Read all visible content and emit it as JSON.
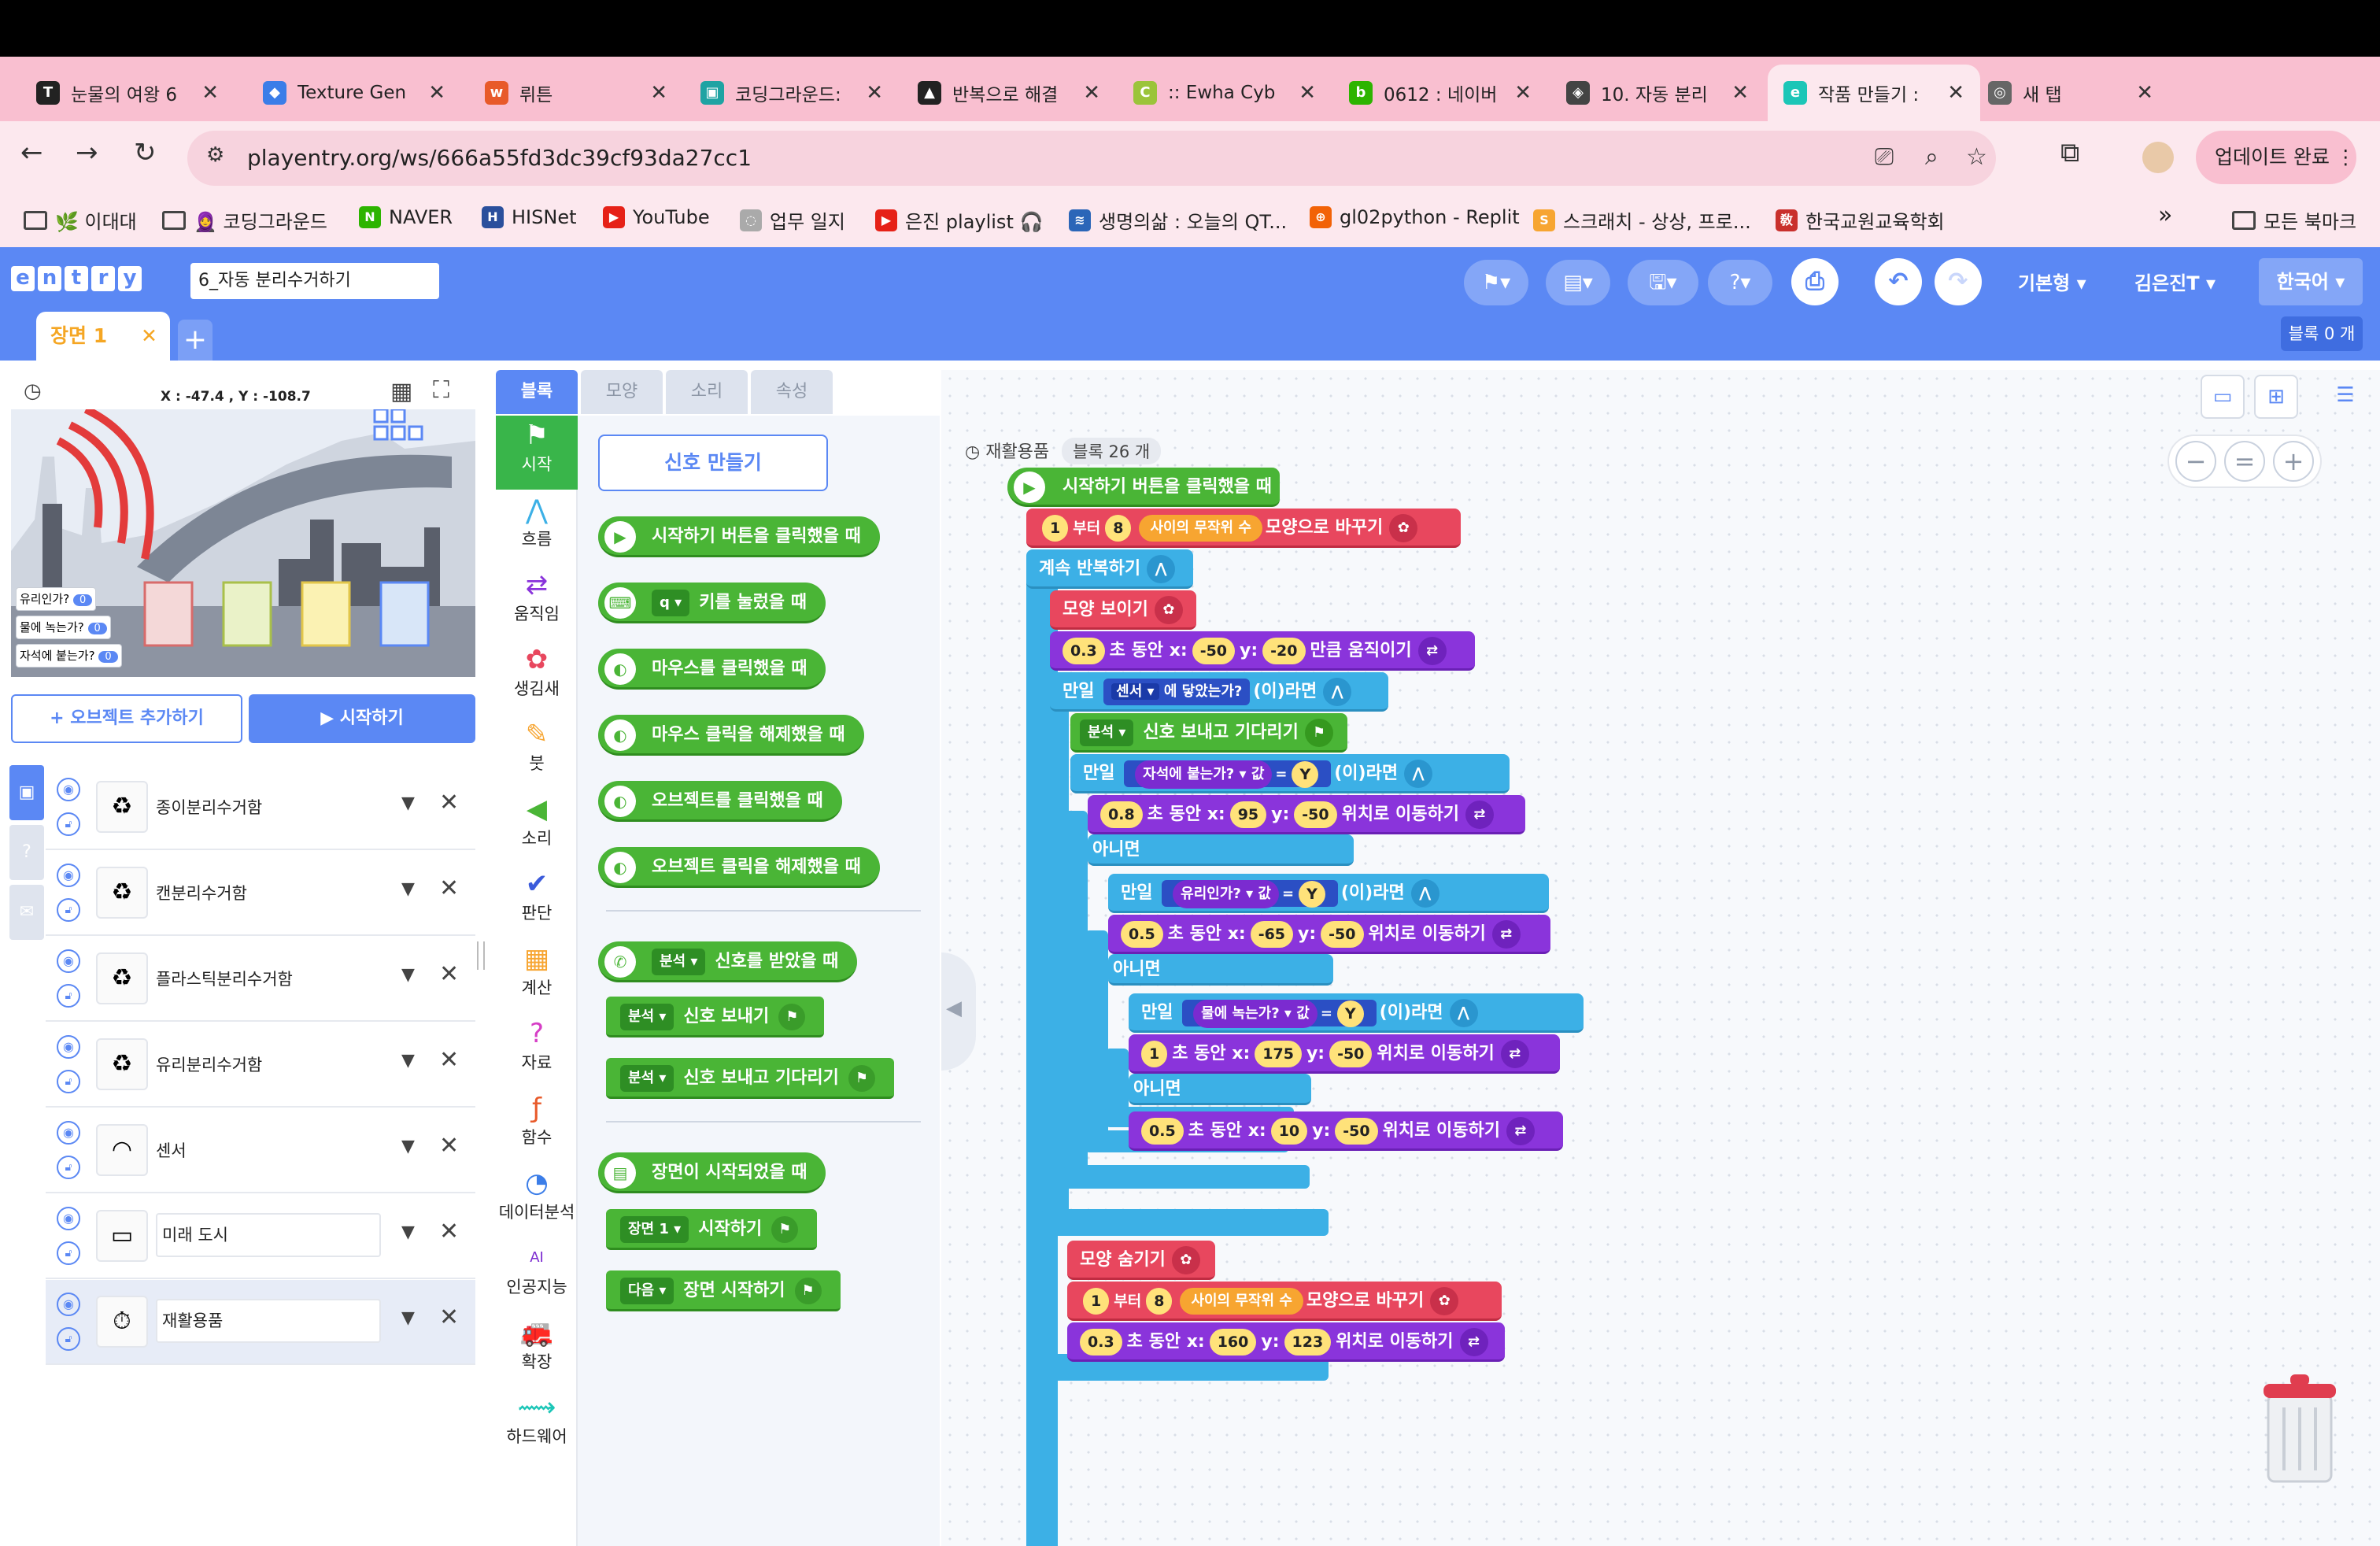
{
  "browser": {
    "tabs": [
      {
        "title": "눈물의 여왕 6",
        "fav": "T",
        "color": "#222"
      },
      {
        "title": "Texture Gen",
        "fav": "◆",
        "color": "#3b7de8"
      },
      {
        "title": "뤼튼",
        "fav": "w",
        "color": "#e85a2a"
      },
      {
        "title": "코딩그라운드:",
        "fav": "▣",
        "color": "#1fa3a3"
      },
      {
        "title": "반복으로 해결",
        "fav": "▲",
        "color": "#222"
      },
      {
        "title": ":: Ewha Cyb",
        "fav": "C",
        "color": "#9bc43a"
      },
      {
        "title": "0612 : 네이버",
        "fav": "b",
        "color": "#2db400"
      },
      {
        "title": "10. 자동 분리",
        "fav": "◈",
        "color": "#444"
      },
      {
        "title": "작품 만들기 :",
        "fav": "e",
        "color": "#1cc6b7"
      },
      {
        "title": "새 탭",
        "fav": "◎",
        "color": "#666"
      }
    ],
    "new_tab": "+",
    "url": "playentry.org/ws/666a55fd3dc39cf93da27cc1",
    "update_label": "업데이트 완료",
    "bookmarks": [
      {
        "label": "🌿 이대대",
        "icon": "folder"
      },
      {
        "label": "🧕 코딩그라운드",
        "icon": "folder"
      },
      {
        "label": "NAVER",
        "icon": "N",
        "color": "#2db400"
      },
      {
        "label": "HISNet",
        "icon": "H",
        "color": "#2a4f9c"
      },
      {
        "label": "YouTube",
        "icon": "▶",
        "color": "#e62117"
      },
      {
        "label": "업무 일지",
        "icon": "◌",
        "color": "#aaa"
      },
      {
        "label": "은진 playlist 🎧",
        "icon": "▶",
        "color": "#e62117"
      },
      {
        "label": "생명의삶 : 오늘의 QT...",
        "icon": "≋",
        "color": "#2b66b8"
      },
      {
        "label": "gl02python - Replit",
        "icon": "⊕",
        "color": "#f26207"
      },
      {
        "label": "스크래치 - 상상, 프로...",
        "icon": "S",
        "color": "#f7a531"
      },
      {
        "label": "한국교원교육학회",
        "icon": "敎",
        "color": "#c9302c"
      }
    ],
    "more": "»",
    "all_bookmarks": "모든 북마크"
  },
  "entry": {
    "logo": [
      "e",
      "n",
      "t",
      "r",
      "y"
    ],
    "project_name": "6_자동 분리수거하기",
    "mode": "기본형",
    "user": "김은진T",
    "language": "한국어",
    "scene_tab": "장면 1",
    "block_count": "블록 0 개",
    "coords": "X : -47.4 , Y : -108.7",
    "stage_vars": [
      {
        "label": "유리인가?",
        "value": "0"
      },
      {
        "label": "물에 녹는가?",
        "value": "0"
      },
      {
        "label": "자석에 붙는가?",
        "value": "0"
      }
    ],
    "add_object": "+ 오브젝트 추가하기",
    "start": "▶ 시작하기",
    "objects": [
      {
        "name": "종이분리수거함",
        "icon": "♻"
      },
      {
        "name": "캔분리수거함",
        "icon": "♻"
      },
      {
        "name": "플라스틱분리수거함",
        "icon": "♻"
      },
      {
        "name": "유리분리수거함",
        "icon": "♻"
      },
      {
        "name": "센서",
        "icon": "◠"
      },
      {
        "name": "미래 도시",
        "icon": "▭"
      },
      {
        "name": "재활용품",
        "icon": "⏱"
      }
    ],
    "palette_tabs": [
      "블록",
      "모양",
      "소리",
      "속성"
    ],
    "categories": [
      {
        "label": "시작",
        "icon": "⚑",
        "color": "#fff"
      },
      {
        "label": "흐름",
        "icon": "⋀",
        "color": "#3cb0e6"
      },
      {
        "label": "움직임",
        "icon": "⇄",
        "color": "#8a34db"
      },
      {
        "label": "생김새",
        "icon": "✿",
        "color": "#e8475e"
      },
      {
        "label": "붓",
        "icon": "✎",
        "color": "#f7a531"
      },
      {
        "label": "소리",
        "icon": "◀",
        "color": "#4ab536"
      },
      {
        "label": "판단",
        "icon": "✔",
        "color": "#3b5bdb"
      },
      {
        "label": "계산",
        "icon": "▦",
        "color": "#f7a531"
      },
      {
        "label": "자료",
        "icon": "?",
        "color": "#d63ec6"
      },
      {
        "label": "함수",
        "icon": "ƒ",
        "color": "#e85a2a"
      },
      {
        "label": "데이터분석",
        "icon": "◔",
        "color": "#3b7de8"
      },
      {
        "label": "인공지능",
        "icon": "AI",
        "color": "#7b2bd0"
      },
      {
        "label": "확장",
        "icon": "🚒",
        "color": "#e8475e"
      },
      {
        "label": "하드웨어",
        "icon": "⟿",
        "color": "#1cc6b7"
      }
    ],
    "make_signal": "신호 만들기",
    "palette_blocks": {
      "b1": "시작하기 버튼을 클릭했을 때",
      "b2_key": "q ▾",
      "b2": "키를 눌렀을 때",
      "b3": "마우스를 클릭했을 때",
      "b4": "마우스 클릭을 해제했을 때",
      "b5": "오브젝트를 클릭했을 때",
      "b6": "오브젝트 클릭을 해제했을 때",
      "b7_sig": "분석 ▾",
      "b7": "신호를 받았을 때",
      "b8_sig": "분석 ▾",
      "b8": "신호 보내기",
      "b9_sig": "분석 ▾",
      "b9": "신호 보내고 기다리기",
      "b10": "장면이 시작되었을 때",
      "b11_scene": "장면 1 ▾",
      "b11": "시작하기",
      "b12_next": "다음 ▾",
      "b12": "장면 시작하기"
    },
    "workspace": {
      "object_name": "재활용품",
      "block_count": "블록 26 개",
      "zoom": [
        "−",
        "=",
        "+"
      ],
      "script": {
        "s1": "시작하기 버튼을 클릭했을 때",
        "s2a": "1",
        "s2b": "부터",
        "s2c": "8",
        "s2d": "사이의 무작위 수",
        "s2e": "모양으로 바꾸기",
        "s3": "계속 반복하기",
        "s4": "모양 보이기",
        "s5a": "0.3",
        "s5b": "초 동안 x:",
        "s5c": "-50",
        "s5d": "y:",
        "s5e": "-20",
        "s5f": "만큼 움직이기",
        "s6a": "만일",
        "s6b": "센서 ▾",
        "s6c": "에 닿았는가?",
        "s6d": "(이)라면",
        "s7a": "분석 ▾",
        "s7b": "신호 보내고 기다리기",
        "s8a": "만일",
        "s8b": "자석에 붙는가? ▾",
        "s8c": "값",
        "s8d": "=",
        "s8e": "Y",
        "s8f": "(이)라면",
        "s9a": "0.8",
        "s9b": "초 동안 x:",
        "s9c": "95",
        "s9d": "y:",
        "s9e": "-50",
        "s9f": "위치로 이동하기",
        "s10": "아니면",
        "s11a": "만일",
        "s11b": "유리인가? ▾",
        "s11c": "값",
        "s11d": "=",
        "s11e": "Y",
        "s11f": "(이)라면",
        "s12a": "0.5",
        "s12b": "초 동안 x:",
        "s12c": "-65",
        "s12d": "y:",
        "s12e": "-50",
        "s12f": "위치로 이동하기",
        "s13": "아니면",
        "s14a": "만일",
        "s14b": "물에 녹는가? ▾",
        "s14c": "값",
        "s14d": "=",
        "s14e": "Y",
        "s14f": "(이)라면",
        "s15a": "1",
        "s15b": "초 동안 x:",
        "s15c": "175",
        "s15d": "y:",
        "s15e": "-50",
        "s15f": "위치로 이동하기",
        "s16": "아니면",
        "s17a": "0.5",
        "s17b": "초 동안 x:",
        "s17c": "10",
        "s17d": "y:",
        "s17e": "-50",
        "s17f": "위치로 이동하기",
        "s18": "모양 숨기기",
        "s19a": "1",
        "s19b": "부터",
        "s19c": "8",
        "s19d": "사이의 무작위 수",
        "s19e": "모양으로 바꾸기",
        "s20a": "0.3",
        "s20b": "초 동안 x:",
        "s20c": "160",
        "s20d": "y:",
        "s20e": "123",
        "s20f": "위치로 이동하기"
      }
    }
  }
}
